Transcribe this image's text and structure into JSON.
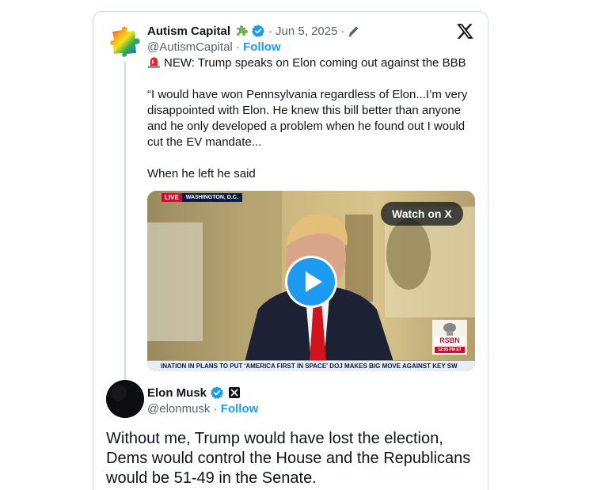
{
  "parent_tweet": {
    "author_name": "Autism Capital",
    "affiliation_icon": "puzzle-piece-icon",
    "verified": true,
    "separator": "·",
    "date": "Jun 5, 2025",
    "date_separator": "·",
    "edited_icon": "pencil-icon",
    "handle": "@AutismCapital",
    "handle_separator": "·",
    "follow_label": "Follow",
    "text_line1": "NEW: Trump speaks on Elon coming out against the BBB",
    "text_line1_emoji": "siren-icon",
    "quote": "“I would have won Pennsylvania regardless of Elon...I’m very disappointed with Elon. He knew this bill better than anyone and he only developed a problem when he found out I would cut the EV mandate...",
    "text_last": "When he left he said"
  },
  "video": {
    "watch_label": "Watch on X",
    "live_label": "LIVE",
    "location_label": "WASHINGTON, D.C.",
    "ticker_text": "INATION IN PLANS TO PUT 'AMERICA FIRST IN SPACE'     DOJ MAKES BIG MOVE AGAINST KEY SW",
    "watermark_label": "RSBN",
    "watermark_time": "12:05 PM ET"
  },
  "reply_tweet": {
    "author_name": "Elon Musk",
    "verified": true,
    "affiliation_icon": "x-logo-badge-icon",
    "handle": "@elonmusk",
    "handle_separator": "·",
    "follow_label": "Follow",
    "text": "Without me, Trump would have lost the election, Dems would control the House and the Republicans would be 51-49 in the Senate."
  },
  "colors": {
    "link_blue": "#1d9bf0",
    "text_primary": "#0f1419",
    "text_secondary": "#536471",
    "border": "#cfd9de"
  }
}
